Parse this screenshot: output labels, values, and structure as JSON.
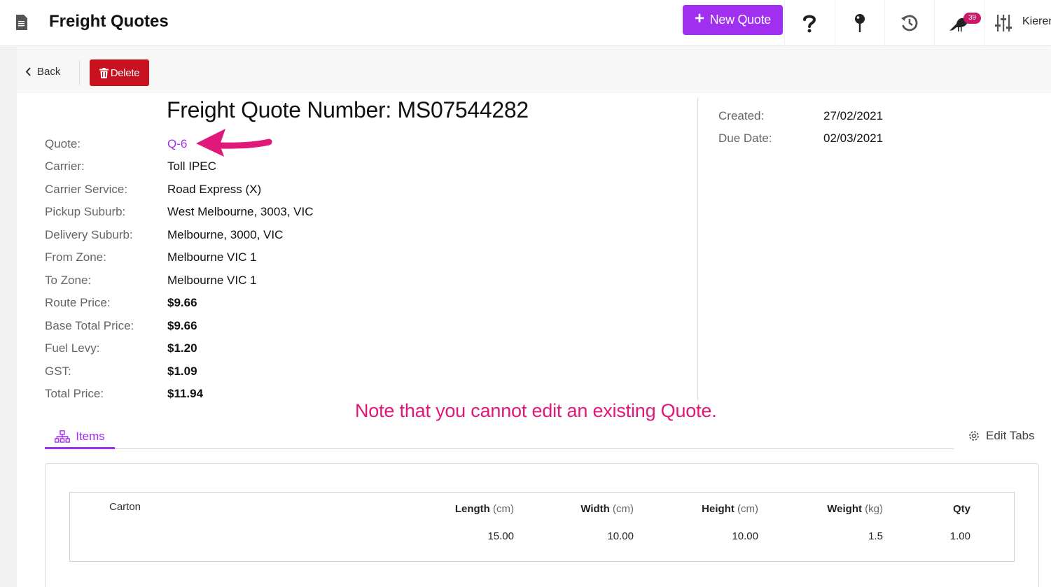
{
  "header": {
    "title": "Freight Quotes",
    "new_button_label": "New Quote",
    "notification_count": "39",
    "user_name": "Kieren"
  },
  "toolbar": {
    "back_label": "Back",
    "delete_label": "Delete"
  },
  "quote": {
    "headline": "Freight Quote Number: MS07544282",
    "fields": [
      {
        "label": "Quote:",
        "value": "Q-6"
      },
      {
        "label": "Carrier:",
        "value": "Toll IPEC"
      },
      {
        "label": "Carrier Service:",
        "value": "Road Express (X)"
      },
      {
        "label": "Pickup Suburb:",
        "value": "West Melbourne, 3003, VIC"
      },
      {
        "label": "Delivery Suburb:",
        "value": "Melbourne, 3000, VIC"
      },
      {
        "label": "From Zone:",
        "value": "Melbourne VIC 1"
      },
      {
        "label": "To Zone:",
        "value": "Melbourne VIC 1"
      },
      {
        "label": "Route Price:",
        "value": "$9.66"
      },
      {
        "label": "Base Total Price:",
        "value": "$9.66"
      },
      {
        "label": "Fuel Levy:",
        "value": "$1.20"
      },
      {
        "label": "GST:",
        "value": "$1.09"
      },
      {
        "label": "Total Price:",
        "value": "$11.94"
      }
    ],
    "meta": [
      {
        "label": "Created:",
        "value": "27/02/2021"
      },
      {
        "label": "Due Date:",
        "value": "02/03/2021"
      }
    ]
  },
  "annotation": {
    "note": "Note that you cannot edit an existing Quote."
  },
  "tabs": {
    "items_label": "Items",
    "edit_tabs_label": "Edit Tabs"
  },
  "items": {
    "name": "Carton",
    "columns": [
      {
        "name": "Length",
        "unit": "(cm)"
      },
      {
        "name": "Width",
        "unit": "(cm)"
      },
      {
        "name": "Height",
        "unit": "(cm)"
      },
      {
        "name": "Weight",
        "unit": "(kg)"
      },
      {
        "name": "Qty",
        "unit": ""
      }
    ],
    "values": [
      "15.00",
      "10.00",
      "10.00",
      "1.5",
      "1.00"
    ]
  },
  "colors": {
    "accent": "#a12ff0",
    "danger": "#c8101e",
    "annotation": "#e0187a",
    "badge": "#c8196b"
  }
}
